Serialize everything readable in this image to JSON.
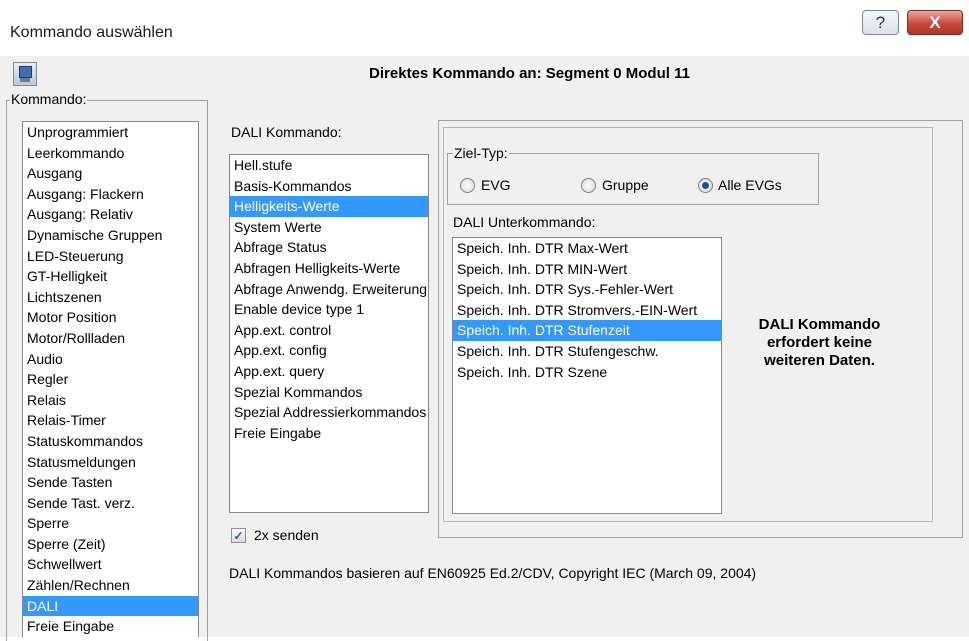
{
  "window": {
    "title": "Kommando auswählen",
    "help_glyph": "?",
    "close_glyph": "X"
  },
  "header": {
    "icon": "computer-icon",
    "title": "Direktes Kommando an: Segment 0 Modul 11"
  },
  "kommando": {
    "legend": "Kommando:",
    "items": [
      "Unprogrammiert",
      "Leerkommando",
      "Ausgang",
      "Ausgang: Flackern",
      "Ausgang: Relativ",
      "Dynamische Gruppen",
      "LED-Steuerung",
      "GT-Helligkeit",
      "Lichtszenen",
      "Motor Position",
      "Motor/Rollladen",
      "Audio",
      "Regler",
      "Relais",
      "Relais-Timer",
      "Statuskommandos",
      "Statusmeldungen",
      "Sende Tasten",
      "Sende Tast. verz.",
      "Sperre",
      "Sperre (Zeit)",
      "Schwellwert",
      "Zählen/Rechnen",
      "DALI",
      "Freie Eingabe"
    ],
    "selected": "DALI"
  },
  "dali": {
    "label": "DALI Kommando:",
    "items": [
      "Hell.stufe",
      "Basis-Kommandos",
      "Helligkeits-Werte",
      "System Werte",
      "Abfrage Status",
      "Abfragen Helligkeits-Werte",
      "Abfrage Anwendg. Erweiterung",
      "Enable device type 1",
      "App.ext. control",
      "App.ext. config",
      "App.ext. query",
      "Spezial Kommandos",
      "Spezial Addressierkommandos",
      "Freie Eingabe"
    ],
    "selected": "Helligkeits-Werte",
    "send_twice_label": "2x senden",
    "send_twice_checked": true,
    "copyright": "DALI Kommandos basieren auf EN60925 Ed.2/CDV, Copyright IEC (March 09, 2004)"
  },
  "ziel_typ": {
    "legend": "Ziel-Typ:",
    "options": [
      "EVG",
      "Gruppe",
      "Alle EVGs"
    ],
    "selected": "Alle EVGs"
  },
  "unterkommando": {
    "label": "DALI Unterkommando:",
    "items": [
      "Speich. Inh. DTR Max-Wert",
      "Speich. Inh. DTR MIN-Wert",
      "Speich. Inh. DTR Sys.-Fehler-Wert",
      "Speich. Inh. DTR Stromvers.-EIN-Wert",
      "Speich. Inh. DTR Stufenzeit",
      "Speich. Inh. DTR Stufengeschw.",
      "Speich. Inh. DTR Szene"
    ],
    "selected": "Speich. Inh. DTR Stufenzeit"
  },
  "info": {
    "line1": "DALI Kommando",
    "line2": "erfordert keine",
    "line3": "weiteren Daten."
  }
}
